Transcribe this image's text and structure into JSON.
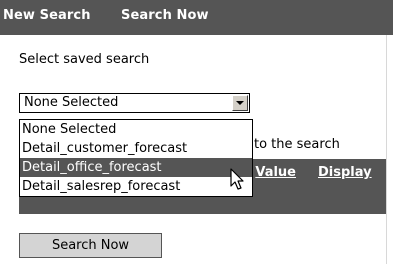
{
  "header": {
    "tabs": [
      {
        "label": "New Search"
      },
      {
        "label": "Search Now"
      }
    ]
  },
  "form": {
    "prompt": "Select saved search",
    "select": {
      "value": "None Selected",
      "options": [
        "None Selected",
        "Detail_customer_forecast",
        "Detail_office_forecast",
        "Detail_salesrep_forecast"
      ],
      "highlighted_option": "Detail_office_forecast"
    },
    "partial_text": "to the search"
  },
  "columns_bar": {
    "value_label": "Value",
    "display_label": "Display"
  },
  "actions": {
    "search_now_label": "Search Now"
  },
  "icons": [
    "dropdown-arrow-icon",
    "mouse-pointer-icon"
  ],
  "colors": {
    "header_bg": "#555555",
    "highlight_bg": "#555555",
    "button_bg": "#d4d4d4"
  }
}
